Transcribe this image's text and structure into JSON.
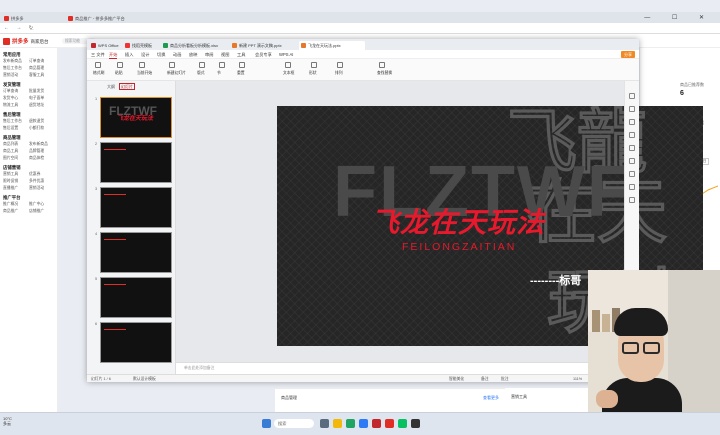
{
  "browser": {
    "tabs": [
      "拼多多",
      "商品推广 - 拼多多推广平台"
    ],
    "url": "...",
    "win_controls": "— ☐ ✕"
  },
  "dashboard": {
    "logo_text": "拼多多",
    "logo_sub": "商家后台",
    "search_placeholder": "搜索功能",
    "sidebar_sections": [
      {
        "title": "常用应用",
        "items": [
          "发布新商品",
          "订单查询",
          "售后工作台",
          "商品管理",
          "营销活动",
          "客服工具"
        ]
      },
      {
        "title": "发货管理",
        "items": [
          "订单查询",
          "批量发货",
          "发货中心",
          "电子面单",
          "物流工具",
          "退货地址"
        ]
      },
      {
        "title": "售后管理",
        "items": [
          "售后工作台",
          "退款退货",
          "售后设置",
          "小额打款"
        ]
      },
      {
        "title": "商品管理",
        "items": [
          "商品列表",
          "发布新商品",
          "商品工具",
          "品牌管理",
          "图片空间",
          "商品体检"
        ]
      },
      {
        "title": "店铺营销",
        "items": [
          "营销工具",
          "优惠券",
          "限时促销",
          "多件优惠",
          "直播推广",
          "营销活动"
        ]
      },
      {
        "title": "推广平台",
        "items": [
          "推广概况",
          "推广中心",
          "商品推广",
          "店铺推广"
        ]
      }
    ],
    "right_panel": {
      "kpi1_label": "商品已推荐数",
      "kpi1_value": "6",
      "kpi2_label": "物流服务数据",
      "kpi2_value": "0",
      "tabs": [
        "近7日",
        "近30日",
        "更多"
      ]
    },
    "bottom": {
      "left_label": "商品管理",
      "link": "查看更多",
      "right_label": "营销工具"
    }
  },
  "wps": {
    "tabs": [
      "WPS Office",
      "找稻壳模板",
      "商品分析看板分析模板.xlsx",
      "新建 PPT 演示文稿.pptx",
      "飞龙在天玩法.pptx"
    ],
    "menu": [
      "三 文件",
      "开始",
      "插入",
      "设计",
      "切换",
      "动画",
      "放映",
      "审阅",
      "视图",
      "工具",
      "会员专享",
      "WPS AI"
    ],
    "share_label": "分享",
    "ribbon_labels": [
      "格式刷",
      "粘贴",
      "当前开始",
      "新建幻灯片",
      "版式",
      "节",
      "重置",
      "文本框",
      "形状",
      "排列",
      "查找替换"
    ],
    "thumb_tabs": [
      "大纲",
      "幻灯片"
    ],
    "slide_count": 6,
    "note_placeholder": "单击此处添加备注",
    "status_left": "幻灯片 1 / 6",
    "status_theme": "默认设计模板",
    "status_right": [
      "智能美化",
      "备注",
      "批注"
    ],
    "zoom": "111%"
  },
  "slide": {
    "bg_word": "FLZTWF",
    "title": "飞龙在天玩法",
    "subtitle": "FEILONGZAITIAN",
    "signature": "--------标哥"
  },
  "taskbar": {
    "weather_temp": "10°C",
    "weather_desc": "多云",
    "search_label": "搜索"
  },
  "colors": {
    "accent_red": "#e8192c",
    "pdd_red": "#e02e24",
    "wps_orange": "#f08a24",
    "slide_bg": "#262626"
  }
}
